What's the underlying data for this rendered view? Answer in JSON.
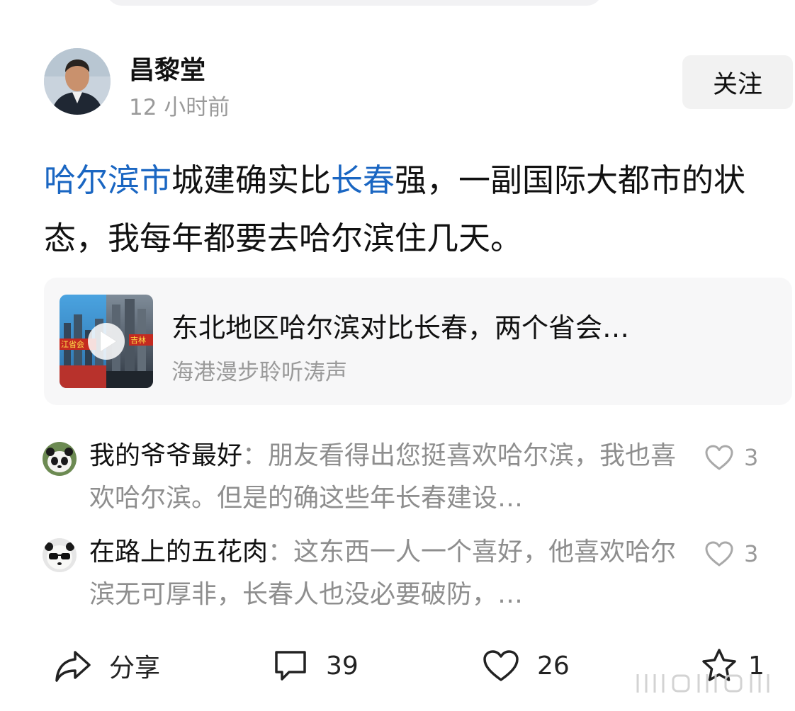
{
  "author": {
    "name": "昌黎堂",
    "time": "12 小时前",
    "follow_label": "关注"
  },
  "post": {
    "segments": [
      {
        "text": "哈尔滨市",
        "type": "topic"
      },
      {
        "text": "城建确实比",
        "type": "text"
      },
      {
        "text": "长春",
        "type": "topic"
      },
      {
        "text": "强，一副国际大都市的状态，我每年都要去哈尔滨住几天。",
        "type": "text"
      }
    ]
  },
  "link_card": {
    "title": "东北地区哈尔滨对比长春，两个省会…",
    "source": "海港漫步聆听涛声",
    "thumb_left_text": "江省会",
    "thumb_right_text": "吉林"
  },
  "comments": [
    {
      "user": "我的爷爷最好",
      "separator": "：",
      "text": "朋友看得出您挺喜欢哈尔滨，我也喜欢哈尔滨。但是的确这些年长春建设…",
      "likes": "3"
    },
    {
      "user": "在路上的五花肉",
      "separator": "：",
      "text": "这东西一人一个喜好，他喜欢哈尔滨无可厚非，长春人也没必要破防，…",
      "likes": "3"
    }
  ],
  "actions": {
    "share_label": "分享",
    "comment_count": "39",
    "like_count": "26",
    "favorite_count": "1"
  },
  "colors": {
    "topic_link": "#1a66c2",
    "muted_text": "#9a9a9a",
    "card_background": "#f7f7f8"
  },
  "icons": {
    "share": "share-arrow-icon",
    "comment": "comment-bubble-icon",
    "like": "heart-icon",
    "favorite": "star-icon"
  }
}
